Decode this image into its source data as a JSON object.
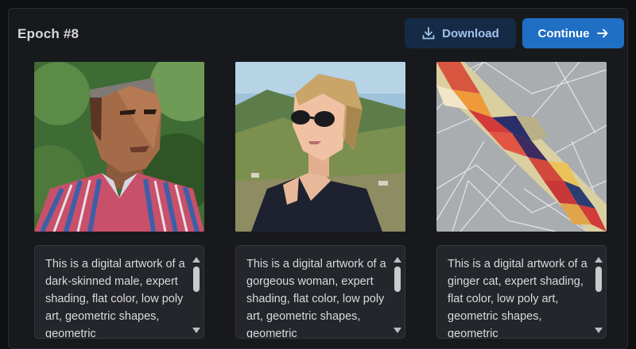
{
  "header": {
    "title": "Epoch #8",
    "download_label": "Download",
    "continue_label": "Continue"
  },
  "icons": {
    "download": "download-icon",
    "continue": "arrow-right-icon"
  },
  "colors": {
    "panel_bg": "#18191d",
    "download_bg": "#152a45",
    "download_text": "#9fc3ee",
    "continue_bg": "#1f6fc4"
  },
  "cards": [
    {
      "image": "portrait of dark-skinned man in striped shirt, low poly style",
      "caption": "This is a digital artwork of a dark-skinned male, expert shading, flat color, low poly art, geometric shapes, geometric"
    },
    {
      "image": "woman with sunglasses and short blonde hair before green hills",
      "caption": "This is a digital artwork of a gorgeous woman, expert shading, flat color, low poly art, geometric shapes, geometric"
    },
    {
      "image": "abstract gray triangular mosaic with colorful diagonal band",
      "caption": "This is a digital artwork of a ginger cat, expert shading, flat color, low poly art, geometric shapes, geometric"
    }
  ]
}
